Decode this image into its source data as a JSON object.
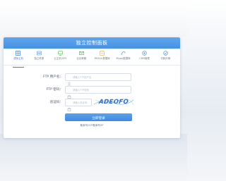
{
  "panel": {
    "title": "独立控制面板"
  },
  "tabs": [
    {
      "label": "虚拟主机",
      "icon": "server-grid-icon",
      "color": "#3b7dd8",
      "active": true
    },
    {
      "label": "独立资源",
      "icon": "database-icon",
      "color": "#3b7dd8",
      "active": false
    },
    {
      "label": "云主机/VPS",
      "icon": "monitor-icon",
      "color": "#4cae4c",
      "active": false
    },
    {
      "label": "企业邮箱",
      "icon": "mail-icon",
      "color": "#4cae4c",
      "active": false
    },
    {
      "label": "MSSQL数据库",
      "icon": "mssql-icon",
      "color": "#e6a23c",
      "active": false
    },
    {
      "label": "Mysql数据库",
      "icon": "mysql-icon",
      "color": "#3b7dd8",
      "active": false
    },
    {
      "label": "CDN管理",
      "icon": "cdn-icon",
      "color": "#3b7dd8",
      "active": false
    },
    {
      "label": "付款存储",
      "icon": "storage-icon",
      "color": "#3b7dd8",
      "active": false
    }
  ],
  "form": {
    "ftp_user_label": "FTP 用户名：",
    "ftp_user_placeholder": "请输入FTP用户名",
    "ftp_pass_label": "FTP 密码：",
    "ftp_pass_placeholder": "请输入FTP密码",
    "captcha_label": "验证码：",
    "captcha_placeholder": "请输入验证码",
    "captcha_text": "ADEOFO",
    "login_button": "立即登录",
    "footer_note": "备案号/ICP备案号/IP"
  },
  "colors": {
    "accent": "#4a90e2",
    "header": "#5fa6ef",
    "button": "#3f89df"
  }
}
